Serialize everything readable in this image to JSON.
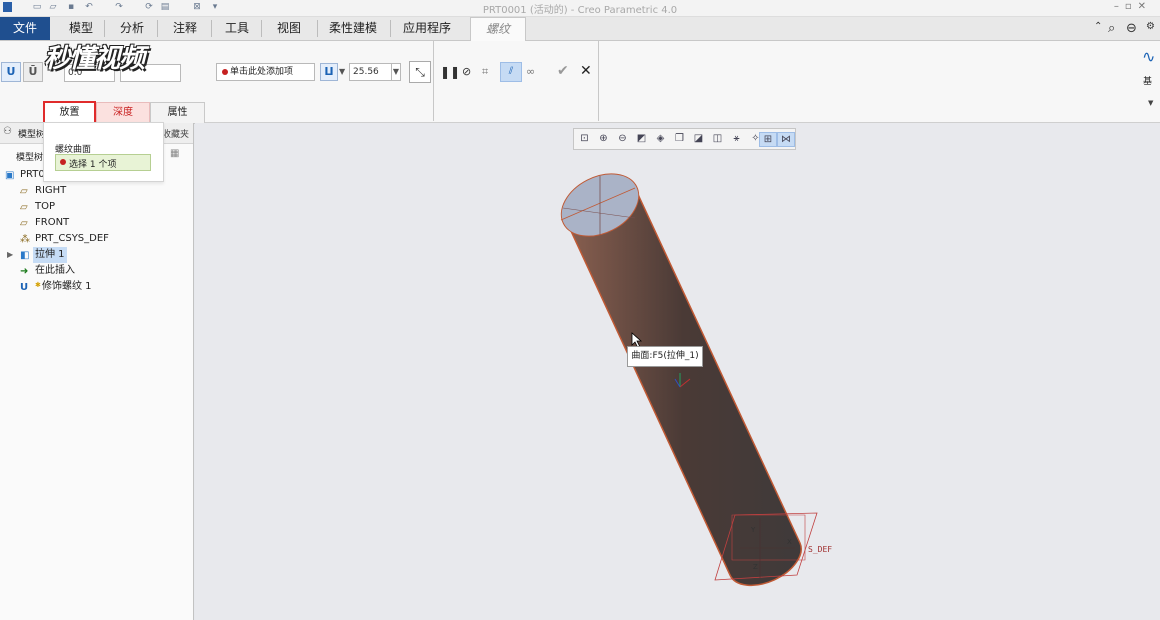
{
  "window": {
    "title": "PRT0001 (活动的) - Creo Parametric 4.0"
  },
  "menu": {
    "items": [
      "文件",
      "模型",
      "分析",
      "注释",
      "工具",
      "视图",
      "柔性建模",
      "应用程序"
    ],
    "active": "螺纹"
  },
  "watermark": "秒懂视频",
  "ribbon": {
    "field1": "0.0",
    "field2": "",
    "add_item_hint": "单击此处添加项",
    "depth_value": "25.56",
    "right_group_label": "基",
    "tabs": [
      "放置",
      "深度",
      "属性"
    ]
  },
  "popup": {
    "title": "螺纹曲面",
    "select_hint": "选择 1 个项"
  },
  "panel": {
    "header": "模型树",
    "sub": "模型树",
    "folder_tab": "收藏夹"
  },
  "tree": [
    {
      "label": "PRT0",
      "icon": "part-icon"
    },
    {
      "label": "RIGHT",
      "icon": "datum-plane-icon"
    },
    {
      "label": "TOP",
      "icon": "datum-plane-icon"
    },
    {
      "label": "FRONT",
      "icon": "datum-plane-icon"
    },
    {
      "label": "PRT_CSYS_DEF",
      "icon": "csys-icon"
    },
    {
      "label": "拉伸 1",
      "icon": "extrude-icon"
    },
    {
      "label": "在此插入",
      "icon": "insert-arrow-icon"
    },
    {
      "label": "修饰螺纹 1",
      "icon": "cosmetic-thread-icon"
    }
  ],
  "tooltip": "曲面:F5(拉伸_1)",
  "csys_label": "S_DEF",
  "colors": {
    "file_tab": "#1f4f8f",
    "cylinder": "#5a4540",
    "highlight_tab": "#e02b2b"
  }
}
